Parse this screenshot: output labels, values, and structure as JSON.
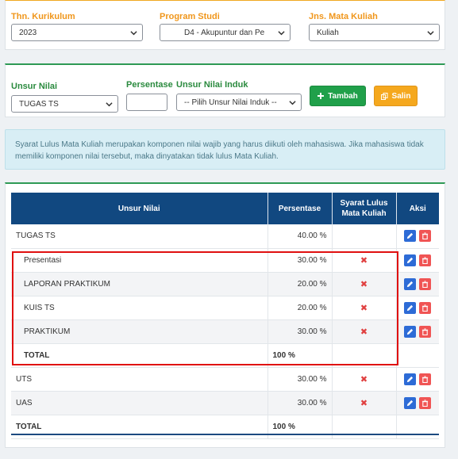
{
  "filters": {
    "tahun_label": "Thn. Kurikulum",
    "tahun_value": "2023",
    "prodi_label": "Program Studi",
    "prodi_value": "D4 - Akupuntur dan Pe",
    "jenis_label": "Jns. Mata Kuliah",
    "jenis_value": "Kuliah"
  },
  "entry": {
    "unsur_label": "Unsur Nilai",
    "unsur_value": "TUGAS TS",
    "persentase_label": "Persentase",
    "persentase_value": "",
    "induk_label": "Unsur Nilai Induk",
    "induk_value": "-- Pilih Unsur Nilai Induk --",
    "tambah_label": "Tambah",
    "salin_label": "Salin"
  },
  "alert_text": "Syarat Lulus Mata Kuliah merupakan komponen nilai wajib yang harus diikuti oleh mahasiswa. Jika mahasiswa tidak memiliki komponen nilai tersebut, maka dinyatakan tidak lulus Mata Kuliah.",
  "table": {
    "headers": {
      "unsur": "Unsur Nilai",
      "persentase": "Persentase",
      "syarat_1": "Syarat Lulus",
      "syarat_2": "Mata Kuliah",
      "aksi": "Aksi"
    },
    "rows": [
      {
        "name": "TUGAS TS",
        "pct": "40.00 %",
        "syarat": "",
        "actions": true,
        "level": 0
      },
      {
        "name": "Presentasi",
        "pct": "30.00 %",
        "syarat": "✖",
        "actions": true,
        "level": 1
      },
      {
        "name": "LAPORAN PRAKTIKUM",
        "pct": "20.00 %",
        "syarat": "✖",
        "actions": true,
        "level": 1
      },
      {
        "name": "KUIS TS",
        "pct": "20.00 %",
        "syarat": "✖",
        "actions": true,
        "level": 1
      },
      {
        "name": "PRAKTIKUM",
        "pct": "30.00 %",
        "syarat": "✖",
        "actions": true,
        "level": 1
      },
      {
        "name": "TOTAL",
        "pct": "100 %",
        "syarat": "",
        "actions": false,
        "level": 1,
        "bold": true
      },
      {
        "name": "UTS",
        "pct": "30.00 %",
        "syarat": "✖",
        "actions": true,
        "level": 0
      },
      {
        "name": "UAS",
        "pct": "30.00 %",
        "syarat": "✖",
        "actions": true,
        "level": 0
      },
      {
        "name": "TOTAL",
        "pct": "100 %",
        "syarat": "",
        "actions": false,
        "level": 0,
        "bold": true
      }
    ]
  },
  "colors": {
    "header_bg": "#114880",
    "accent_orange": "#f0961b",
    "accent_green": "#2a8a3e",
    "highlight_red": "#e01010"
  }
}
